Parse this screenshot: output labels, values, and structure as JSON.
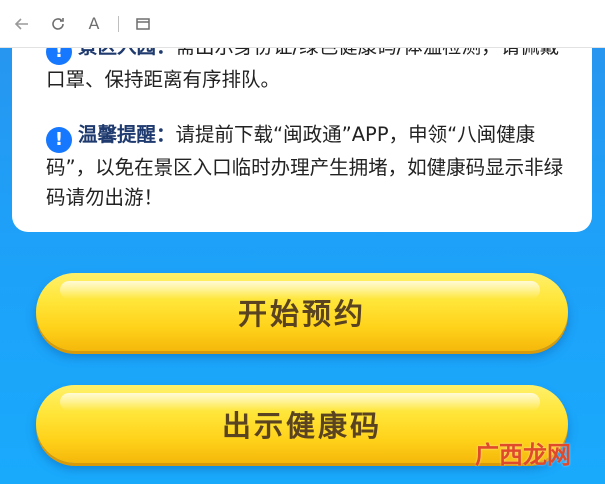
{
  "toolbar": {
    "back_label": "←",
    "refresh_label": "⟳",
    "reader_label": "A",
    "window_label": "▭"
  },
  "notice": {
    "item1_label": "景区入园：",
    "item1_text": "需出示身份证/绿色健康码/体温检测，请佩戴口罩、保持距离有序排队。",
    "item2_label": "温馨提醒：",
    "item2_text": "请提前下载“闽政通”APP，申领“八闽健康码”，以免在景区入口临时办理产生拥堵，如健康码显示非绿码请勿出游！"
  },
  "buttons": {
    "reserve_label": "开始预约",
    "health_code_label": "出示健康码"
  },
  "watermark": "广西龙网",
  "colors": {
    "background": "#1ea0f8",
    "card": "#ffffff",
    "button": "#ffd21a",
    "icon": "#1677ff"
  }
}
